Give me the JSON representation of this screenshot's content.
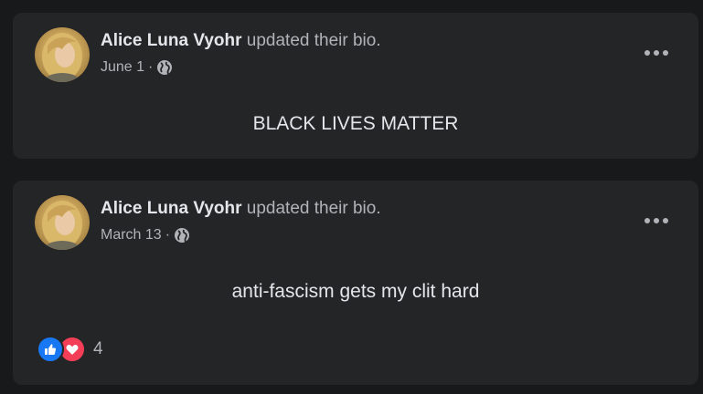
{
  "posts": [
    {
      "author": "Alice Luna Vyohr",
      "action": "updated their bio.",
      "date": "June 1",
      "separator": "·",
      "privacy_icon": "globe-icon",
      "bio": "BLACK LIVES MATTER",
      "menu_icon": "more-options-icon"
    },
    {
      "author": "Alice Luna Vyohr",
      "action": "updated their bio.",
      "date": "March 13",
      "separator": "·",
      "privacy_icon": "globe-icon",
      "bio": "anti-fascism gets my clit hard",
      "menu_icon": "more-options-icon",
      "reactions": {
        "icons": [
          "like-icon",
          "love-icon"
        ],
        "count": "4"
      }
    }
  ],
  "colors": {
    "background": "#18191a",
    "card": "#242526",
    "primary_text": "#e4e6eb",
    "secondary_text": "#b0b3b8",
    "like": "#1877f2",
    "love": "#f33e58"
  }
}
